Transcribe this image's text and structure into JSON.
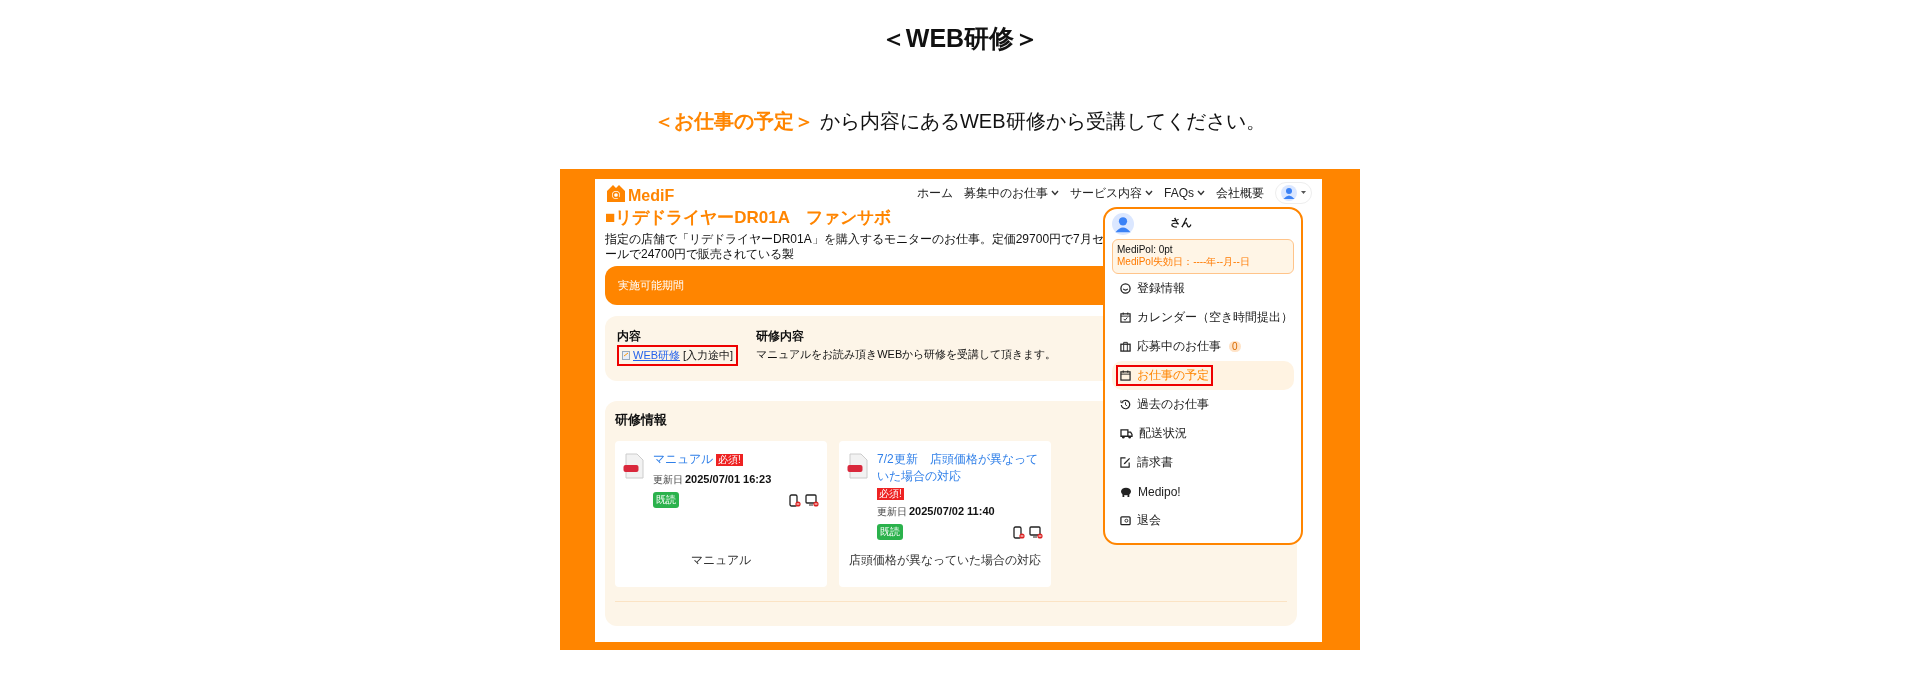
{
  "heading": "＜WEB研修＞",
  "instruction": {
    "highlight": "＜お仕事の予定＞",
    "text": "から内容にあるWEB研修から受講してください。"
  },
  "screenshot": {
    "logo": "MediF",
    "nav": [
      {
        "label": "ホーム",
        "dropdown": false
      },
      {
        "label": "募集中のお仕事",
        "dropdown": true
      },
      {
        "label": "サービス内容",
        "dropdown": true
      },
      {
        "label": "FAQs",
        "dropdown": true
      },
      {
        "label": "会社概要",
        "dropdown": false
      }
    ],
    "job_title": "■リデドライヤーDR01A　ファンサボ",
    "description": "指定の店舗で「リデドライヤーDR01A」を購入するモニターのお仕事。定価29700円で7月セールで24700円で販売されている製",
    "period_bar": "実施可能期間",
    "content": {
      "heading": "内容",
      "link": "WEB研修",
      "status": "[入力途中]",
      "highlighted": true
    },
    "training_content": {
      "heading": "研修内容",
      "text": "マニュアルをお読み頂きWEBから研修を受講して頂きます。"
    },
    "training_info": {
      "heading": "研修情報",
      "documents": [
        {
          "title": "マニュアル",
          "required_badge": "必須!",
          "updated_label": "更新日",
          "updated": "2025/07/01 16:23",
          "read_badge": "既読",
          "caption": "マニュアル"
        },
        {
          "title": "7/2更新　店頭価格が異なっていた場合の対応",
          "required_badge": "必須!",
          "updated_label": "更新日",
          "updated": "2025/07/02 11:40",
          "read_badge": "既読",
          "caption": "店頭価格が異なっていた場合の対応"
        }
      ]
    },
    "user_menu": {
      "name": "さん",
      "points": "MediPol: 0pt",
      "expiry": "MediPol失効日：----年--月--日",
      "items": [
        {
          "label": "登録情報",
          "selected": false,
          "highlighted": false
        },
        {
          "label": "カレンダー（空き時間提出）",
          "selected": false,
          "highlighted": false
        },
        {
          "label": "応募中のお仕事",
          "selected": false,
          "highlighted": false,
          "count": "0"
        },
        {
          "label": "お仕事の予定",
          "selected": true,
          "highlighted": true
        },
        {
          "label": "過去のお仕事",
          "selected": false,
          "highlighted": false
        },
        {
          "label": "配送状況",
          "selected": false,
          "highlighted": false
        },
        {
          "label": "請求書",
          "selected": false,
          "highlighted": false
        },
        {
          "label": "Medipo!",
          "selected": false,
          "highlighted": false
        },
        {
          "label": "退会",
          "selected": false,
          "highlighted": false
        }
      ]
    }
  }
}
